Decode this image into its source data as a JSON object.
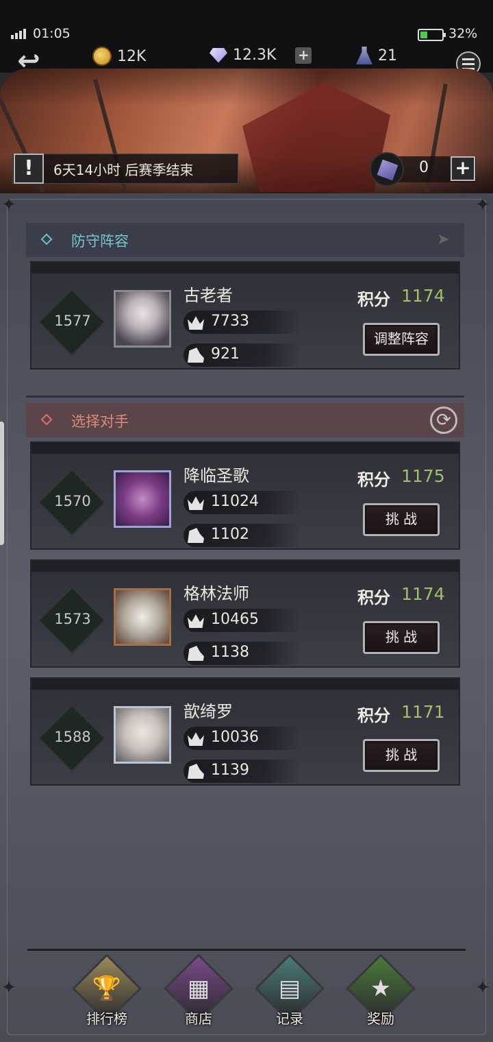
{
  "status_bar": {
    "time": "01:05",
    "battery_pct": "32%",
    "battery_level": 0.32
  },
  "resources": {
    "coins": "12K",
    "gems": "12.3K",
    "flasks": "21"
  },
  "season": {
    "text": "6天14小时 后赛季结束",
    "tickets": "0"
  },
  "defense": {
    "title": "防守阵容",
    "rank": "1577",
    "name": "古老者",
    "power": "7733",
    "speed": "921",
    "score_label": "积分",
    "score": "1174",
    "button": "调整阵容"
  },
  "opponents": {
    "title": "选择对手",
    "list": [
      {
        "rank": "1570",
        "name": "降临圣歌",
        "power": "11024",
        "speed": "1102",
        "score_label": "积分",
        "score": "1175",
        "button": "挑 战"
      },
      {
        "rank": "1573",
        "name": "格林法师",
        "power": "10465",
        "speed": "1138",
        "score_label": "积分",
        "score": "1174",
        "button": "挑 战"
      },
      {
        "rank": "1588",
        "name": "歆绮罗",
        "power": "10036",
        "speed": "1139",
        "score_label": "积分",
        "score": "1171",
        "button": "挑 战"
      }
    ]
  },
  "nav": [
    {
      "label": "排行榜",
      "icon": "trophy-icon",
      "color": "#9a8a5a"
    },
    {
      "label": "商店",
      "icon": "chest-icon",
      "color": "#7a4a8a"
    },
    {
      "label": "记录",
      "icon": "scroll-icon",
      "color": "#4a7a78"
    },
    {
      "label": "奖励",
      "icon": "money-bag-icon",
      "color": "#4a7a3a"
    }
  ],
  "colors": {
    "score_green": "#9fbf6a",
    "defense_accent": "#7cc4cc",
    "opponent_accent": "#e08a7d"
  }
}
